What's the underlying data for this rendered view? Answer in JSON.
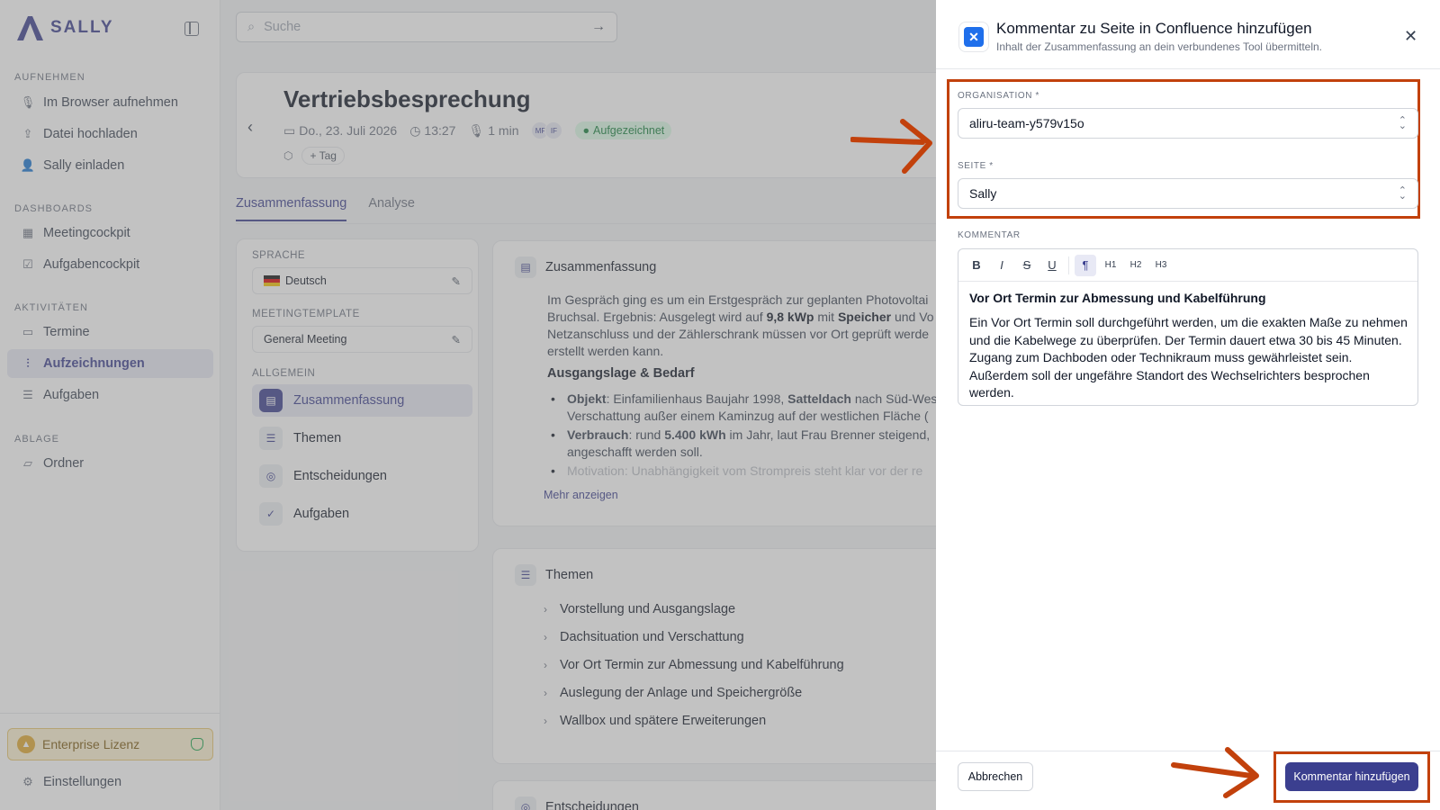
{
  "app": {
    "brand": "SALLY"
  },
  "sidebar": {
    "sections": [
      {
        "label": "AUFNEHMEN",
        "items": [
          {
            "label": "Im Browser aufnehmen",
            "icon": "mic-icon"
          },
          {
            "label": "Datei hochladen",
            "icon": "upload-icon"
          },
          {
            "label": "Sally einladen",
            "icon": "user-plus-icon"
          }
        ]
      },
      {
        "label": "DASHBOARDS",
        "items": [
          {
            "label": "Meetingcockpit",
            "icon": "grid-icon"
          },
          {
            "label": "Aufgabencockpit",
            "icon": "checkbox-icon"
          }
        ]
      },
      {
        "label": "AKTIVITÄTEN",
        "items": [
          {
            "label": "Termine",
            "icon": "calendar-icon"
          },
          {
            "label": "Aufzeichnungen",
            "icon": "waveform-icon"
          },
          {
            "label": "Aufgaben",
            "icon": "list-check-icon"
          }
        ]
      },
      {
        "label": "ABLAGE",
        "items": [
          {
            "label": "Ordner",
            "icon": "folder-icon"
          }
        ]
      }
    ],
    "license": "Enterprise Lizenz",
    "settings": "Einstellungen"
  },
  "search": {
    "placeholder": "Suche"
  },
  "meeting": {
    "title": "Vertriebsbesprechung",
    "date": "Do., 23. Juli 2026",
    "time": "13:27",
    "duration": "1 min",
    "participants": [
      "MF",
      "IF"
    ],
    "status": "Aufgezeichnet",
    "tag_button": "Tag"
  },
  "tabs": [
    "Zusammenfassung",
    "Analyse"
  ],
  "left_panel": {
    "language_label": "SPRACHE",
    "language": "Deutsch",
    "template_label": "MEETINGTEMPLATE",
    "template": "General Meeting",
    "general_label": "ALLGEMEIN",
    "items": [
      "Zusammenfassung",
      "Themen",
      "Entscheidungen",
      "Aufgaben"
    ]
  },
  "summary": {
    "heading": "Zusammenfassung",
    "para_line1": "Im Gespräch ging es um ein Erstgespräch zur geplanten Photovoltai",
    "para_line2_a": "Bruchsal. Ergebnis: Ausgelegt wird auf ",
    "para_line2_b": "9,8 kWp",
    "para_line2_c": " mit ",
    "para_line2_d": "Speicher",
    "para_line2_e": " und Vo",
    "para_line3": "Netzanschluss und der Zählerschrank müssen vor Ort geprüft werde",
    "para_line4": "erstellt werden kann.",
    "subheading": "Ausgangslage & Bedarf",
    "b1_label": "Objekt",
    "b1_text_a": ": Einfamilienhaus Baujahr 1998, ",
    "b1_text_b": "Satteldach",
    "b1_text_c": " nach Süd-Wes",
    "b1_line2": "Verschattung außer einem Kaminzug auf der westlichen Fläche (",
    "b2_label": "Verbrauch",
    "b2_text_a": ": rund ",
    "b2_text_b": "5.400 kWh",
    "b2_text_c": " im Jahr, laut Frau Brenner steigend, ",
    "b2_line2": "angeschafft werden soll.",
    "b3_label": "Motivation",
    "b3_text": ": Unabhängigkeit vom Strompreis steht klar vor der re",
    "more": "Mehr anzeigen"
  },
  "topics": {
    "heading": "Themen",
    "items": [
      "Vorstellung und Ausgangslage",
      "Dachsituation und Verschattung",
      "Vor Ort Termin zur Abmessung und Kabelführung",
      "Auslegung der Anlage und Speichergröße",
      "Wallbox und spätere Erweiterungen"
    ],
    "next_heading": "Entscheidungen"
  },
  "modal": {
    "title": "Kommentar zu Seite in Confluence hinzufügen",
    "subtitle": "Inhalt der Zusammenfassung an dein verbundenes Tool übermitteln.",
    "org_label": "ORGANISATION *",
    "org_value": "aliru-team-y579v15o",
    "page_label": "SEITE *",
    "page_value": "Sally",
    "comment_label": "KOMMENTAR",
    "toolbar": [
      "B",
      "I",
      "S",
      "U",
      "¶",
      "H1",
      "H2",
      "H3"
    ],
    "comment_heading": "Vor Ort Termin zur Abmessung und Kabelführung",
    "comment_body": "Ein Vor Ort Termin soll durchgeführt werden, um die exakten Maße zu nehmen und die Kabelwege zu überprüfen. Der Termin dauert etwa 30 bis 45 Minuten. Zugang zum Dachboden oder Technikraum muss gewährleistet sein. Außerdem soll der ungefähre Standort des Wechselrichters besprochen werden.",
    "cancel": "Abbrechen",
    "submit": "Kommentar hinzufügen"
  },
  "colors": {
    "accent": "#3b3f8f",
    "highlight": "#c2410c"
  }
}
